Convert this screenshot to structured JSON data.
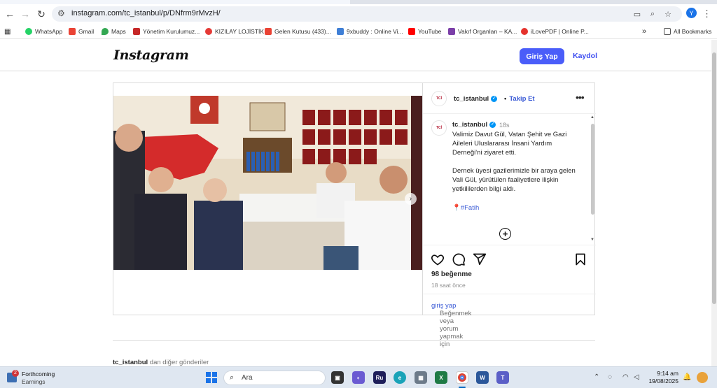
{
  "browser": {
    "url": "instagram.com/tc_istanbul/p/DNfrm9rMvzH/",
    "bookmarks": [
      {
        "label": "WhatsApp",
        "color": "#25d366"
      },
      {
        "label": "Gmail",
        "color": "#ea4335"
      },
      {
        "label": "Maps",
        "color": "#34a853"
      },
      {
        "label": "Yönetim Kurulumuz...",
        "color": "#c62828"
      },
      {
        "label": "KIZILAY LOJİSTİK",
        "color": "#e53935"
      },
      {
        "label": "Gelen Kutusu (433)...",
        "color": "#ea4335"
      },
      {
        "label": "9xbuddy : Online Vi...",
        "color": "#3f7fd6"
      },
      {
        "label": "YouTube",
        "color": "#ff0000"
      },
      {
        "label": "Vakıf Organları – KA...",
        "color": "#7b3fa8"
      },
      {
        "label": "iLovePDF | Online P...",
        "color": "#e5322d"
      }
    ],
    "all_bookmarks": "All Bookmarks",
    "profile_initial": "Y"
  },
  "instagram": {
    "logo": "Instagram",
    "login_button": "Giriş Yap",
    "signup_link": "Kaydol",
    "post": {
      "username": "tc_istanbul",
      "follow": "Takip Et",
      "separator": "•",
      "caption_time": "18s",
      "caption_p1": "Valimiz Davut Gül, Vatan Şehit ve Gazi Aileleri Uluslararası İnsani Yardım Derneği'ni ziyaret etti.",
      "caption_p2": "Dernek üyesi gazilerimizle bir araya gelen Vali Gül, yürütülen faaliyetlere ilişkin yetkililerden bilgi aldı.",
      "hashtag": "#Fatih",
      "likes": "98 beğenme",
      "posted_ago": "18 saat önce",
      "login_prompt_prefix": "Beğenmek veya yorum yapmak için",
      "login_prompt_link": "giriş yap",
      "login_prompt_suffix": "."
    },
    "more_posts_user": "tc_istanbul",
    "more_posts_text": " dan diğer gönderiler"
  },
  "taskbar": {
    "weather_title": "Forthcoming",
    "weather_sub": "Earnings",
    "weather_badge": "2",
    "search_placeholder": "Ara",
    "time": "9:14 am",
    "date": "19/08/2025"
  }
}
